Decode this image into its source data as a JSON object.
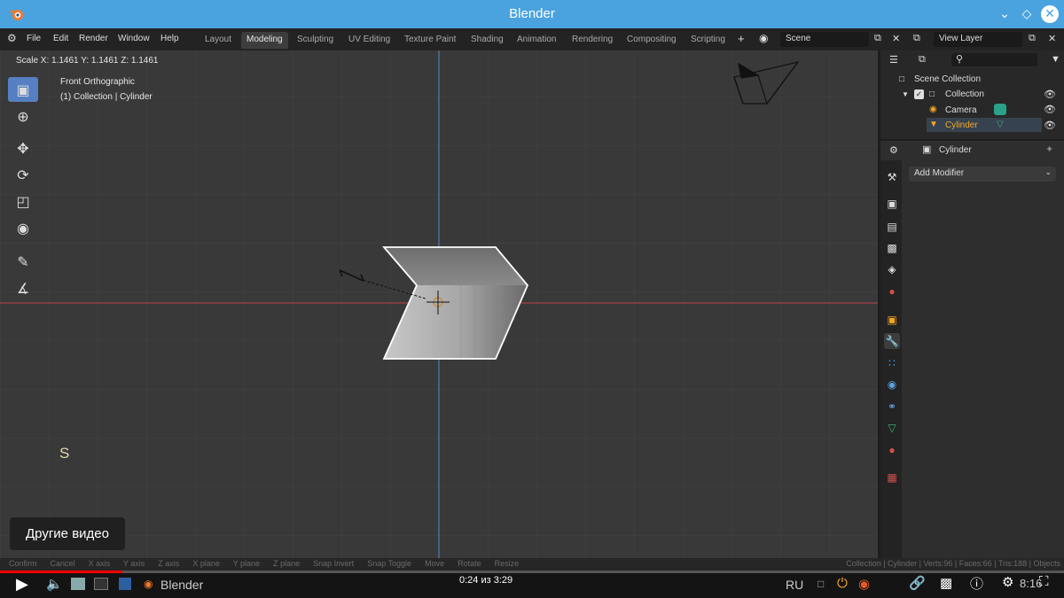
{
  "window": {
    "title": "Blender",
    "controls": [
      "chevron-down-icon",
      "diamond-icon",
      "close-icon"
    ]
  },
  "menu": [
    "File",
    "Edit",
    "Render",
    "Window",
    "Help"
  ],
  "workspaces": [
    "Layout",
    "Modeling",
    "Sculpting",
    "UV Editing",
    "Texture Paint",
    "Shading",
    "Animation",
    "Rendering",
    "Compositing",
    "Scripting"
  ],
  "active_workspace": "Modeling",
  "add_workspace": "+",
  "scene": {
    "value": "Scene"
  },
  "view_layer": {
    "value": "View Layer"
  },
  "viewport": {
    "scale_readout": "Scale X: 1.1461   Y: 1.1461   Z: 1.1461",
    "view_name": "Front Orthographic",
    "collection_label": "(1) Collection | Cylinder",
    "key_hint": "S"
  },
  "tools": [
    "select-box-icon",
    "cursor-icon",
    "move-icon",
    "rotate-icon",
    "scale-icon",
    "transform-icon",
    "annotate-icon",
    "measure-icon"
  ],
  "outliner": {
    "root": "Scene Collection",
    "collection": "Collection",
    "items": [
      {
        "label": "Camera",
        "color": "#dddddd"
      },
      {
        "label": "Cylinder",
        "color": "#f5a623"
      }
    ]
  },
  "properties": {
    "object_name": "Cylinder",
    "add_modifier": "Add Modifier",
    "tabs": [
      "tool-icon",
      "render-icon",
      "output-icon",
      "view-layer-icon",
      "scene-icon",
      "world-icon",
      "object-icon",
      "modifier-icon",
      "particles-icon",
      "physics-icon",
      "constraints-icon",
      "data-icon",
      "material-icon",
      "texture-icon"
    ],
    "active_tab": "modifier-icon"
  },
  "statusbar": {
    "hints": [
      "Confirm",
      "Cancel",
      "X axis",
      "Y axis",
      "Z axis",
      "X plane",
      "Y plane",
      "Z plane",
      "Snap Invert",
      "Snap Toggle",
      "Move",
      "Rotate",
      "Resize"
    ],
    "stats": "Collection | Cylinder | Verts:96 | Faces:66 | Tris:188 | Objects"
  },
  "player": {
    "time": "0:24 из 3:29",
    "progress_fraction": 0.115,
    "language": "RU",
    "taskbar_app": "Blender",
    "clock": "8:16",
    "more_videos": "Другие видео"
  },
  "colors": {
    "accent": "#5680c2",
    "title_bar": "#4aa3df",
    "x_axis": "#a5404a",
    "z_axis": "#4a7fb0",
    "selection_outline": "#ffffff",
    "active_object": "#f5a623"
  }
}
